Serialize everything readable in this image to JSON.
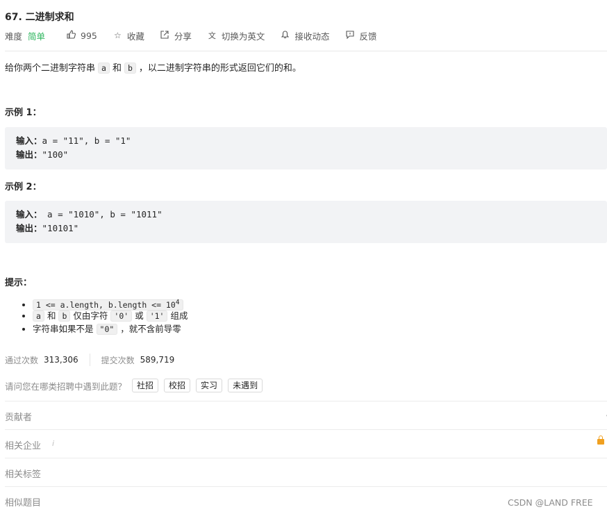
{
  "problem": {
    "title": "67. 二进制求和",
    "difficulty_label": "难度",
    "difficulty_value": "简单",
    "likes": "995",
    "actions": {
      "collect": "收藏",
      "share": "分享",
      "switch_lang": "切换为英文",
      "follow": "接收动态",
      "feedback": "反馈"
    },
    "description": {
      "prefix": "给你两个二进制字符串",
      "a": "a",
      "and": "和",
      "b": "b",
      "suffix": "，以二进制字符串的形式返回它们的和。"
    },
    "example1": {
      "heading": "示例 1：",
      "input_label": "输入：",
      "input_value": "a = \"11\", b = \"1\"",
      "output_label": "输出：",
      "output_value": "\"100\""
    },
    "example2": {
      "heading": "示例 2：",
      "input_label": "输入：",
      "input_value": " a = \"1010\", b = \"1011\"",
      "output_label": "输出：",
      "output_value": "\"10101\""
    },
    "hints": {
      "heading": "提示：",
      "h1_code": "1 <= a.length, b.length <= 10",
      "h1_sup": "4",
      "h2_a": "a",
      "h2_and": "和",
      "h2_b": "b",
      "h2_mid": "仅由字符",
      "h2_zero": "'0'",
      "h2_or": "或",
      "h2_one": "'1'",
      "h2_end": "组成",
      "h3_prefix": "字符串如果不是",
      "h3_code": "\"0\"",
      "h3_suffix": "，就不含前导零"
    }
  },
  "stats": {
    "accepted_label": "通过次数",
    "accepted_value": "313,306",
    "submitted_label": "提交次数",
    "submitted_value": "589,719"
  },
  "survey": {
    "question": "请问您在哪类招聘中遇到此题？",
    "tags": [
      "社招",
      "校招",
      "实习",
      "未遇到"
    ]
  },
  "sections": {
    "contributors": "贡献者",
    "companies": "相关企业",
    "companies_info": "i",
    "tags": "相关标签",
    "similar": "相似题目"
  },
  "watermark": "CSDN @LAND FREE",
  "colors": {
    "easy": "#2db55d",
    "lock": "#f0a020"
  }
}
